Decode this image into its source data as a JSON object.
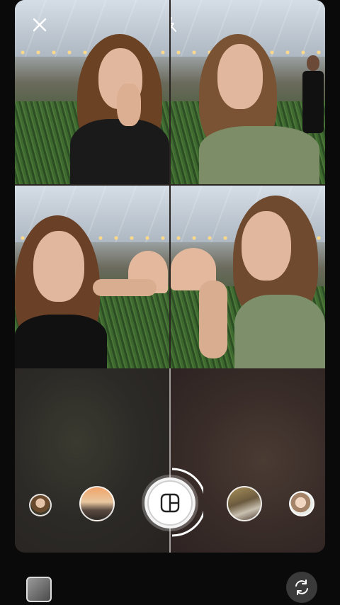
{
  "screen": {
    "layout_mode": "4-tile collage",
    "close_icon": "close-icon",
    "flash_icon": "flash-off-icon",
    "capture_icon": "layout-grid-icon",
    "flip_icon": "flip-camera-icon",
    "gallery_icon": "gallery-thumbnail"
  },
  "filters": [
    {
      "name": "filter-avatar-1"
    },
    {
      "name": "filter-sunset"
    },
    {
      "name": "filter-room"
    },
    {
      "name": "filter-avatar-2"
    }
  ],
  "colors": {
    "background": "#0a0a0a",
    "shutter": "#ffffff",
    "icon": "#ffffff"
  }
}
